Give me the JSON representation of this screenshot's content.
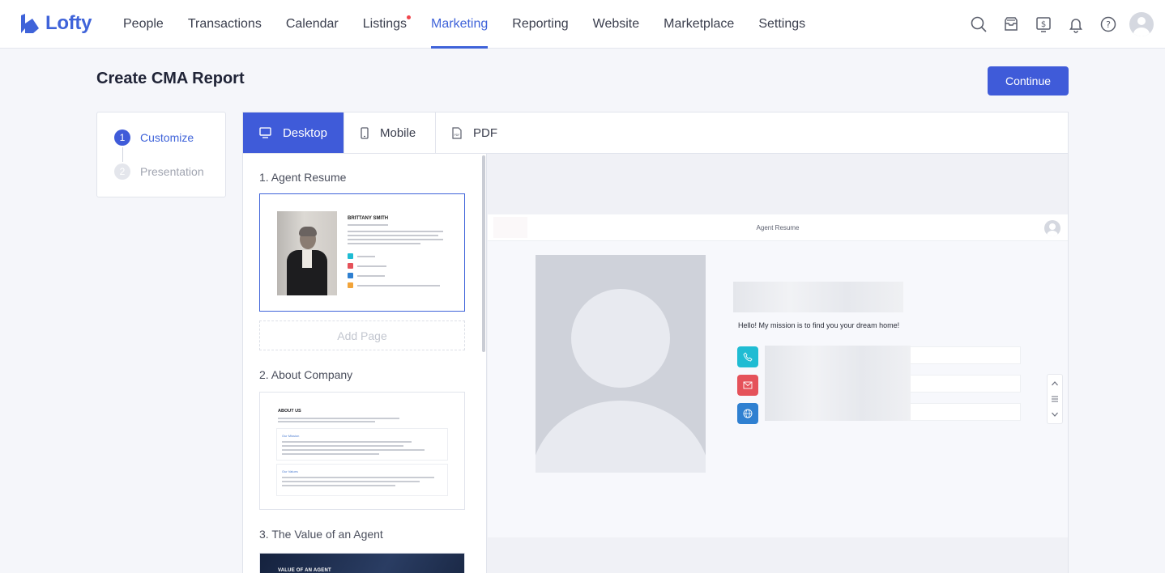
{
  "app": {
    "brand": "Lofty",
    "accent": "#3f5bd9"
  },
  "nav": {
    "items": [
      {
        "label": "People"
      },
      {
        "label": "Transactions"
      },
      {
        "label": "Calendar"
      },
      {
        "label": "Listings",
        "has_dot": true
      },
      {
        "label": "Marketing",
        "active": true
      },
      {
        "label": "Reporting"
      },
      {
        "label": "Website"
      },
      {
        "label": "Marketplace"
      },
      {
        "label": "Settings"
      }
    ],
    "icons": [
      "search-icon",
      "inbox-icon",
      "dollar-icon",
      "bell-icon",
      "help-icon",
      "avatar"
    ]
  },
  "page": {
    "title": "Create CMA Report",
    "continue_label": "Continue"
  },
  "steps": [
    {
      "num": "1",
      "label": "Customize",
      "active": true
    },
    {
      "num": "2",
      "label": "Presentation",
      "active": false
    }
  ],
  "tabs": [
    {
      "label": "Desktop",
      "icon": "monitor-icon",
      "active": true
    },
    {
      "label": "Mobile",
      "icon": "phone-icon",
      "active": false
    },
    {
      "label": "PDF",
      "icon": "pdf-icon",
      "active": false
    }
  ],
  "pages": {
    "sections": [
      {
        "label": "1. Agent Resume"
      },
      {
        "label": "2. About Company"
      },
      {
        "label": "3. The Value of an Agent"
      }
    ],
    "add_page_label": "Add Page",
    "thumb1": {
      "name": "BRITTANY SMITH"
    },
    "thumb2": {
      "title": "ABOUT US",
      "box1": "Our Mission",
      "box2": "Our Values"
    },
    "thumb3": {
      "title": "VALUE OF AN AGENT"
    }
  },
  "preview": {
    "header_title": "Agent Resume",
    "mission": "Hello! My mission is to find you your dream home!",
    "contact_colors": {
      "phone": "#1fbcd3",
      "email": "#e5525a",
      "web": "#2f80d1"
    }
  }
}
